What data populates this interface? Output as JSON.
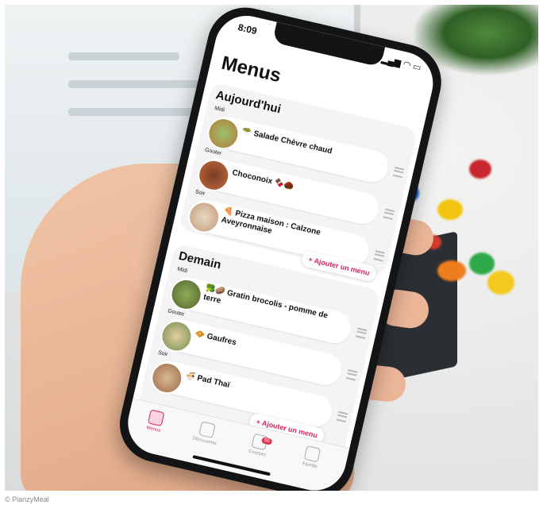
{
  "caption": "© PlanzyMeal",
  "status_bar": {
    "time": "8:09",
    "icons": "▂▄▆ ◠ ▭"
  },
  "app": {
    "title": "Menus",
    "today": {
      "title": "Aujourd'hui",
      "meals": [
        {
          "slot": "Midi",
          "name": "🥗 Salade Chèvre chaud"
        },
        {
          "slot": "Gouter",
          "name": "Choconoix 🍫🌰"
        },
        {
          "slot": "Soir",
          "name": "🍕 Pizza maison : Calzone Aveyronnaise"
        }
      ],
      "add_label": "+ Ajouter un menu"
    },
    "tomorrow": {
      "title": "Demain",
      "meals": [
        {
          "slot": "Midi",
          "name": "🥦🥔 Gratin brocolis - pomme de terre"
        },
        {
          "slot": "Gouter",
          "name": "🧇 Gaufres"
        },
        {
          "slot": "Soir",
          "name": "🍜 Pad Thaï"
        }
      ],
      "add_label": "+ Ajouter un menu"
    },
    "tabs": [
      {
        "label": "Menus",
        "icon": "menus-icon",
        "active": true
      },
      {
        "label": "Découverte",
        "icon": "chef-hat-icon",
        "active": false
      },
      {
        "label": "Courses",
        "icon": "cart-icon",
        "active": false,
        "badge": "50"
      },
      {
        "label": "Famille",
        "icon": "family-icon",
        "active": false
      }
    ]
  },
  "colors": {
    "accent": "#d6245e",
    "badge": "#e3364a",
    "frame": "#131416"
  }
}
